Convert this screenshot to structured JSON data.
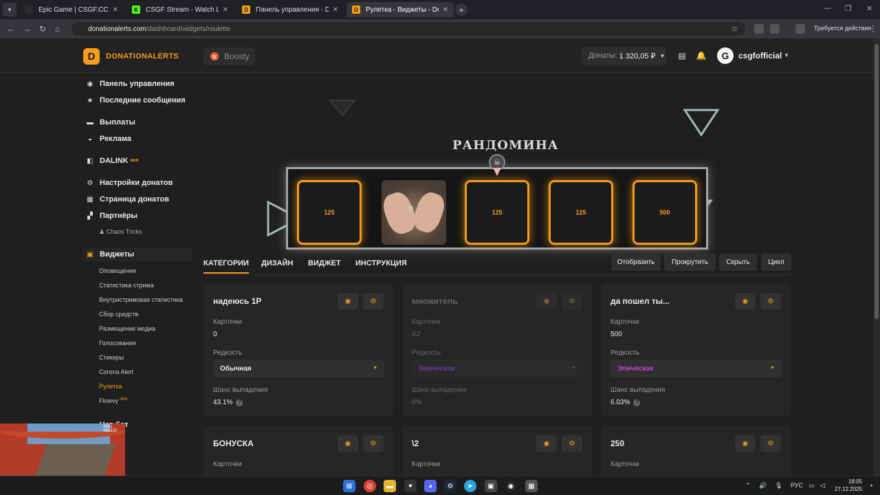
{
  "browser": {
    "tabs": [
      {
        "title": "Epic Game | CSGF.CC"
      },
      {
        "title": "CSGF Stream - Watch Live on K"
      },
      {
        "title": "Панель управления - Donatio"
      },
      {
        "title": "Рулетка - Виджеты - Donational"
      }
    ],
    "url_domain": "donationalerts.com",
    "url_path": "/dashboard/widgets/roulette",
    "account_status": "Требуется действие"
  },
  "header": {
    "brand": "DONATIONALERTS",
    "boosty": "Boosty",
    "donations_label": "Донаты:",
    "donations_value": "1 320,05 ₽",
    "username": "csgfofficial"
  },
  "sidebar": {
    "items": [
      {
        "label": "Панель управления"
      },
      {
        "label": "Последние сообщения"
      },
      {
        "label": "Выплаты"
      },
      {
        "label": "Реклама"
      },
      {
        "label": "DALINK",
        "badge": "NEW"
      },
      {
        "label": "Настройки донатов"
      },
      {
        "label": "Страница донатов"
      },
      {
        "label": "Партнёры"
      }
    ],
    "partners_sub": "Chaos Tricks",
    "widgets": "Виджеты",
    "widget_items": [
      {
        "label": "Оповещения"
      },
      {
        "label": "Статистика стрима"
      },
      {
        "label": "Внутристримовая статистика"
      },
      {
        "label": "Сбор средств"
      },
      {
        "label": "Размещение медиа"
      },
      {
        "label": "Голосования"
      },
      {
        "label": "Стикеры"
      },
      {
        "label": "Corona Alert"
      },
      {
        "label": "Рулетка"
      },
      {
        "label": "Flowvy",
        "badge": "NEW"
      }
    ],
    "more": "Чат-бот"
  },
  "preview": {
    "title": "РАНДОМИНА",
    "cards": [
      "125",
      "0",
      "125",
      "125",
      "500"
    ]
  },
  "tabs": [
    {
      "label": "КАТЕГОРИИ"
    },
    {
      "label": "ДИЗАЙН"
    },
    {
      "label": "ВИДЖЕТ"
    },
    {
      "label": "ИНСТРУКЦИЯ"
    }
  ],
  "actions": [
    "Отобразить",
    "Прокрутить",
    "Скрыть",
    "Цикл"
  ],
  "panels": [
    {
      "title": "надеюсь 1Р",
      "cards_label": "Карточки",
      "cards_value": "0",
      "rarity_label": "Редкость",
      "rarity_value": "Обычная",
      "rarity_color": "#ececec",
      "chance_label": "Шанс выпадения",
      "chance_value": "43.1%"
    },
    {
      "title": "множитель",
      "cards_label": "Карточки",
      "cards_value": "X2",
      "rarity_label": "Редкость",
      "rarity_value": "Эпическая",
      "rarity_color": "#6a3aa0",
      "chance_label": "Шанс выпадения",
      "chance_value": "0%"
    },
    {
      "title": "да пошел ты...",
      "cards_label": "Карточки",
      "cards_value": "500",
      "rarity_label": "Редкость",
      "rarity_value": "Эпическая",
      "rarity_color": "#c73bd6",
      "chance_label": "Шанс выпадения",
      "chance_value": "6.03%"
    },
    {
      "title": "БОНУСКА",
      "cards_label": "Карточки"
    },
    {
      "title": "\\2",
      "cards_label": "Карточки"
    },
    {
      "title": "250",
      "cards_label": "Карточки"
    }
  ],
  "taskbar": {
    "lang": "РУС",
    "time": "18:05",
    "date": "27.12.2025"
  },
  "stream": {
    "hud": "4561 · 486320"
  },
  "accent": "#f59c1a"
}
